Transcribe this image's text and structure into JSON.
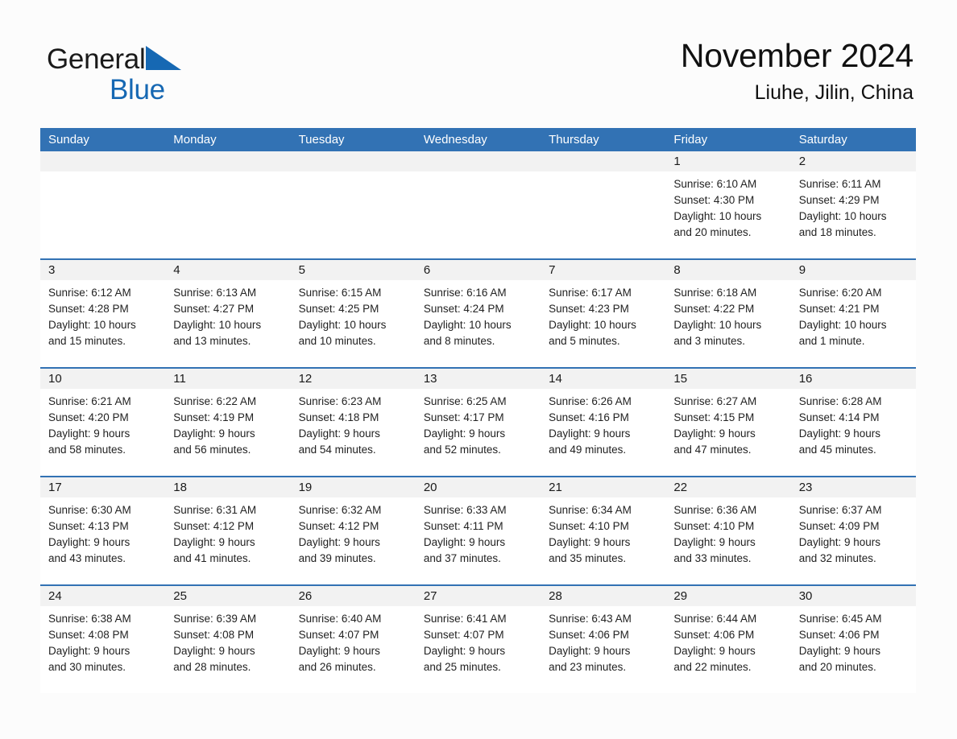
{
  "brand": {
    "word1": "General",
    "word2": "Blue",
    "triangle_color": "#1668b3",
    "icon": "triangle-logo-icon"
  },
  "header": {
    "month_title": "November 2024",
    "location": "Liuhe, Jilin, China"
  },
  "colors": {
    "header_blue": "#3272b4",
    "row_divider_blue": "#3272b4",
    "day_number_band": "#f2f2f2",
    "page_background": "#fcfcfc",
    "brand_blue": "#1668b3"
  },
  "calendar": {
    "weekdays": [
      "Sunday",
      "Monday",
      "Tuesday",
      "Wednesday",
      "Thursday",
      "Friday",
      "Saturday"
    ],
    "weeks": [
      [
        {
          "empty": true,
          "num": "",
          "sunrise": "",
          "sunset": "",
          "daylight1": "",
          "daylight2": ""
        },
        {
          "empty": true,
          "num": "",
          "sunrise": "",
          "sunset": "",
          "daylight1": "",
          "daylight2": ""
        },
        {
          "empty": true,
          "num": "",
          "sunrise": "",
          "sunset": "",
          "daylight1": "",
          "daylight2": ""
        },
        {
          "empty": true,
          "num": "",
          "sunrise": "",
          "sunset": "",
          "daylight1": "",
          "daylight2": ""
        },
        {
          "empty": true,
          "num": "",
          "sunrise": "",
          "sunset": "",
          "daylight1": "",
          "daylight2": ""
        },
        {
          "empty": false,
          "num": "1",
          "sunrise": "Sunrise: 6:10 AM",
          "sunset": "Sunset: 4:30 PM",
          "daylight1": "Daylight: 10 hours",
          "daylight2": "and 20 minutes."
        },
        {
          "empty": false,
          "num": "2",
          "sunrise": "Sunrise: 6:11 AM",
          "sunset": "Sunset: 4:29 PM",
          "daylight1": "Daylight: 10 hours",
          "daylight2": "and 18 minutes."
        }
      ],
      [
        {
          "empty": false,
          "num": "3",
          "sunrise": "Sunrise: 6:12 AM",
          "sunset": "Sunset: 4:28 PM",
          "daylight1": "Daylight: 10 hours",
          "daylight2": "and 15 minutes."
        },
        {
          "empty": false,
          "num": "4",
          "sunrise": "Sunrise: 6:13 AM",
          "sunset": "Sunset: 4:27 PM",
          "daylight1": "Daylight: 10 hours",
          "daylight2": "and 13 minutes."
        },
        {
          "empty": false,
          "num": "5",
          "sunrise": "Sunrise: 6:15 AM",
          "sunset": "Sunset: 4:25 PM",
          "daylight1": "Daylight: 10 hours",
          "daylight2": "and 10 minutes."
        },
        {
          "empty": false,
          "num": "6",
          "sunrise": "Sunrise: 6:16 AM",
          "sunset": "Sunset: 4:24 PM",
          "daylight1": "Daylight: 10 hours",
          "daylight2": "and 8 minutes."
        },
        {
          "empty": false,
          "num": "7",
          "sunrise": "Sunrise: 6:17 AM",
          "sunset": "Sunset: 4:23 PM",
          "daylight1": "Daylight: 10 hours",
          "daylight2": "and 5 minutes."
        },
        {
          "empty": false,
          "num": "8",
          "sunrise": "Sunrise: 6:18 AM",
          "sunset": "Sunset: 4:22 PM",
          "daylight1": "Daylight: 10 hours",
          "daylight2": "and 3 minutes."
        },
        {
          "empty": false,
          "num": "9",
          "sunrise": "Sunrise: 6:20 AM",
          "sunset": "Sunset: 4:21 PM",
          "daylight1": "Daylight: 10 hours",
          "daylight2": "and 1 minute."
        }
      ],
      [
        {
          "empty": false,
          "num": "10",
          "sunrise": "Sunrise: 6:21 AM",
          "sunset": "Sunset: 4:20 PM",
          "daylight1": "Daylight: 9 hours",
          "daylight2": "and 58 minutes."
        },
        {
          "empty": false,
          "num": "11",
          "sunrise": "Sunrise: 6:22 AM",
          "sunset": "Sunset: 4:19 PM",
          "daylight1": "Daylight: 9 hours",
          "daylight2": "and 56 minutes."
        },
        {
          "empty": false,
          "num": "12",
          "sunrise": "Sunrise: 6:23 AM",
          "sunset": "Sunset: 4:18 PM",
          "daylight1": "Daylight: 9 hours",
          "daylight2": "and 54 minutes."
        },
        {
          "empty": false,
          "num": "13",
          "sunrise": "Sunrise: 6:25 AM",
          "sunset": "Sunset: 4:17 PM",
          "daylight1": "Daylight: 9 hours",
          "daylight2": "and 52 minutes."
        },
        {
          "empty": false,
          "num": "14",
          "sunrise": "Sunrise: 6:26 AM",
          "sunset": "Sunset: 4:16 PM",
          "daylight1": "Daylight: 9 hours",
          "daylight2": "and 49 minutes."
        },
        {
          "empty": false,
          "num": "15",
          "sunrise": "Sunrise: 6:27 AM",
          "sunset": "Sunset: 4:15 PM",
          "daylight1": "Daylight: 9 hours",
          "daylight2": "and 47 minutes."
        },
        {
          "empty": false,
          "num": "16",
          "sunrise": "Sunrise: 6:28 AM",
          "sunset": "Sunset: 4:14 PM",
          "daylight1": "Daylight: 9 hours",
          "daylight2": "and 45 minutes."
        }
      ],
      [
        {
          "empty": false,
          "num": "17",
          "sunrise": "Sunrise: 6:30 AM",
          "sunset": "Sunset: 4:13 PM",
          "daylight1": "Daylight: 9 hours",
          "daylight2": "and 43 minutes."
        },
        {
          "empty": false,
          "num": "18",
          "sunrise": "Sunrise: 6:31 AM",
          "sunset": "Sunset: 4:12 PM",
          "daylight1": "Daylight: 9 hours",
          "daylight2": "and 41 minutes."
        },
        {
          "empty": false,
          "num": "19",
          "sunrise": "Sunrise: 6:32 AM",
          "sunset": "Sunset: 4:12 PM",
          "daylight1": "Daylight: 9 hours",
          "daylight2": "and 39 minutes."
        },
        {
          "empty": false,
          "num": "20",
          "sunrise": "Sunrise: 6:33 AM",
          "sunset": "Sunset: 4:11 PM",
          "daylight1": "Daylight: 9 hours",
          "daylight2": "and 37 minutes."
        },
        {
          "empty": false,
          "num": "21",
          "sunrise": "Sunrise: 6:34 AM",
          "sunset": "Sunset: 4:10 PM",
          "daylight1": "Daylight: 9 hours",
          "daylight2": "and 35 minutes."
        },
        {
          "empty": false,
          "num": "22",
          "sunrise": "Sunrise: 6:36 AM",
          "sunset": "Sunset: 4:10 PM",
          "daylight1": "Daylight: 9 hours",
          "daylight2": "and 33 minutes."
        },
        {
          "empty": false,
          "num": "23",
          "sunrise": "Sunrise: 6:37 AM",
          "sunset": "Sunset: 4:09 PM",
          "daylight1": "Daylight: 9 hours",
          "daylight2": "and 32 minutes."
        }
      ],
      [
        {
          "empty": false,
          "num": "24",
          "sunrise": "Sunrise: 6:38 AM",
          "sunset": "Sunset: 4:08 PM",
          "daylight1": "Daylight: 9 hours",
          "daylight2": "and 30 minutes."
        },
        {
          "empty": false,
          "num": "25",
          "sunrise": "Sunrise: 6:39 AM",
          "sunset": "Sunset: 4:08 PM",
          "daylight1": "Daylight: 9 hours",
          "daylight2": "and 28 minutes."
        },
        {
          "empty": false,
          "num": "26",
          "sunrise": "Sunrise: 6:40 AM",
          "sunset": "Sunset: 4:07 PM",
          "daylight1": "Daylight: 9 hours",
          "daylight2": "and 26 minutes."
        },
        {
          "empty": false,
          "num": "27",
          "sunrise": "Sunrise: 6:41 AM",
          "sunset": "Sunset: 4:07 PM",
          "daylight1": "Daylight: 9 hours",
          "daylight2": "and 25 minutes."
        },
        {
          "empty": false,
          "num": "28",
          "sunrise": "Sunrise: 6:43 AM",
          "sunset": "Sunset: 4:06 PM",
          "daylight1": "Daylight: 9 hours",
          "daylight2": "and 23 minutes."
        },
        {
          "empty": false,
          "num": "29",
          "sunrise": "Sunrise: 6:44 AM",
          "sunset": "Sunset: 4:06 PM",
          "daylight1": "Daylight: 9 hours",
          "daylight2": "and 22 minutes."
        },
        {
          "empty": false,
          "num": "30",
          "sunrise": "Sunrise: 6:45 AM",
          "sunset": "Sunset: 4:06 PM",
          "daylight1": "Daylight: 9 hours",
          "daylight2": "and 20 minutes."
        }
      ]
    ]
  }
}
